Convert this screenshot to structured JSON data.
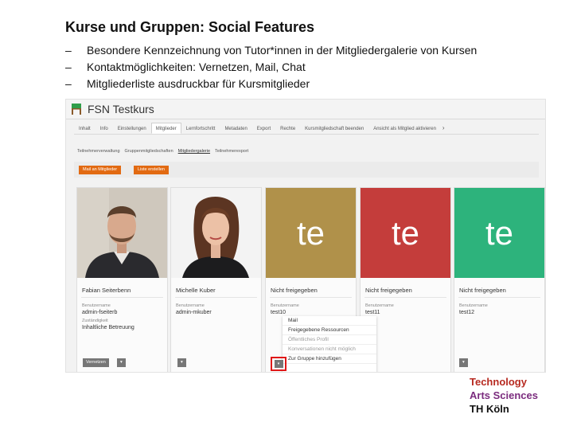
{
  "slide": {
    "title": "Kurse und Gruppen: Social Features",
    "bullet_marker": "–",
    "bullets": [
      "Besondere Kennzeichnung von Tutor*innen in der Mitgliedergalerie von Kursen",
      "Kontaktmöglichkeiten: Vernetzen, Mail, Chat",
      "Mitgliederliste ausdruckbar für Kursmitglieder"
    ]
  },
  "app": {
    "course_title": "FSN Testkurs",
    "nav_tabs": [
      "Inhalt",
      "Info",
      "Einstellungen",
      "Mitglieder",
      "Lernfortschritt",
      "Metadaten",
      "Export",
      "Rechte",
      "Kursmitgliedschaft beenden",
      "Ansicht als Mitglied aktivieren"
    ],
    "nav_more": "›",
    "active_tab": "Mitglieder",
    "subtabs": [
      "Teilnehmerverwaltung",
      "Gruppenmitgliedschaften",
      "Mitgliedergalerie",
      "Teilnehmerexport"
    ],
    "active_subtab": "Mitgliedergalerie",
    "toolbar": {
      "mail_button": "Mail an Mitglieder",
      "list_button": "Liste erstellen"
    },
    "members": [
      {
        "name": "Fabian Seiterbenn",
        "username_label": "Benutzername",
        "username": "admin-fseiterb",
        "role_label": "Zuständigkeit",
        "role": "Inhaltliche Betreuung",
        "button": "Vernetzen",
        "button_arrow": "▾"
      },
      {
        "name": "Michelle Kuber",
        "username_label": "Benutzername",
        "username": "admin-mkuber",
        "button": "▾"
      },
      {
        "name": "Nicht freigegeben",
        "username_label": "Benutzername",
        "username": "test10",
        "tile_text": "te",
        "button": "▾"
      },
      {
        "name": "Nicht freigegeben",
        "username_label": "Benutzername",
        "username": "test11",
        "tile_text": "te",
        "button": "▾"
      },
      {
        "name": "Nicht freigegeben",
        "username_label": "Benutzername",
        "username": "test12",
        "tile_text": "te",
        "button": "▾"
      }
    ],
    "context_menu": [
      {
        "label": "Mail",
        "enabled": true
      },
      {
        "label": "Freigegebene Ressourcen",
        "enabled": true
      },
      {
        "label": "Öffentliches Profil",
        "enabled": false
      },
      {
        "label": "Konversationen nicht möglich",
        "enabled": false
      },
      {
        "label": "Zur Gruppe hinzufügen",
        "enabled": true
      }
    ]
  },
  "logo": {
    "line1": "Technology",
    "line2": "Arts Sciences",
    "line3": "TH Köln"
  },
  "colors": {
    "accent_orange": "#e26a12",
    "tile_gold": "#b0914a",
    "tile_red": "#c43d3b",
    "tile_green": "#2db37c",
    "logo_red": "#b72a20",
    "logo_purple": "#7b2c7e",
    "highlight_red": "#e01818"
  }
}
